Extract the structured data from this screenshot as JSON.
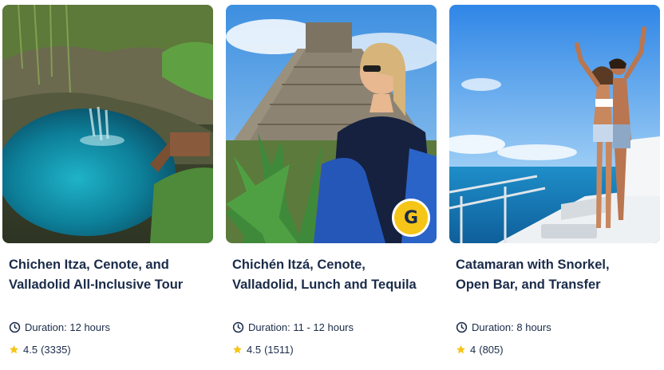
{
  "cards": [
    {
      "title_line1": "Chichen Itza, Cenote, and",
      "title_line2": "Valladolid All-Inclusive Tour",
      "duration_label": "Duration:",
      "duration_value": "12 hours",
      "rating": "4.5",
      "reviews": "(3335)",
      "image": "cenote-photo"
    },
    {
      "title_line1": "Chichén Itzá, Cenote,",
      "title_line2": "Valladolid, Lunch and Tequila",
      "duration_label": "Duration:",
      "duration_value": "11 - 12 hours",
      "rating": "4.5",
      "reviews": "(1511)",
      "image": "pyramid-photo",
      "badge": "G"
    },
    {
      "title_line1": "Catamaran with Snorkel,",
      "title_line2": "Open Bar, and Transfer",
      "duration_label": "Duration:",
      "duration_value": "8 hours",
      "rating": "4",
      "reviews": "(805)",
      "image": "catamaran-photo"
    }
  ],
  "icons": {
    "duration": "clock-icon",
    "rating": "star-icon"
  },
  "colors": {
    "text": "#1a2b49",
    "star": "#f5c518",
    "badge": "#f5c518"
  }
}
